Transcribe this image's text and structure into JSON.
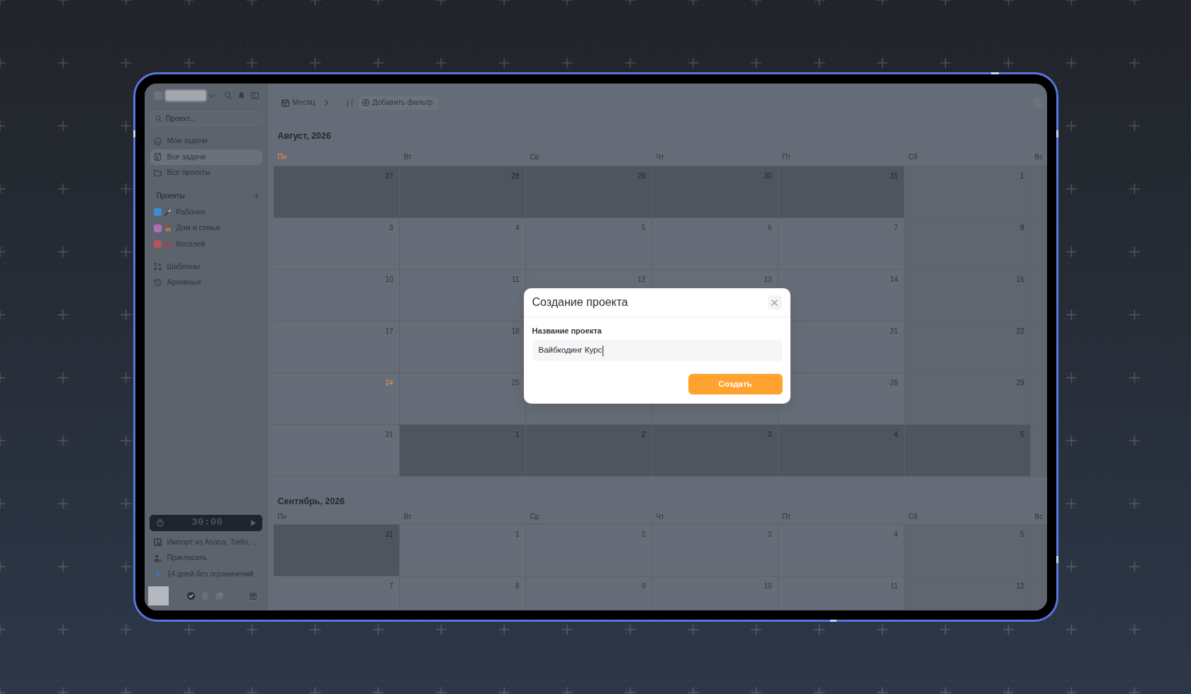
{
  "sidebar": {
    "search": {
      "placeholder": "Проект..."
    },
    "nav": [
      {
        "label": "Мои задачи",
        "selected": false
      },
      {
        "label": "Все задачи",
        "selected": true
      },
      {
        "label": "Все проекты",
        "selected": false
      }
    ],
    "projects_heading": "Проекты",
    "projects": [
      {
        "color": "#3d8bd0",
        "name": "Рабочее"
      },
      {
        "color": "#b36bb5",
        "name": "Дом и семья"
      },
      {
        "color": "#b5525c",
        "name": "Косплей"
      }
    ],
    "links": [
      {
        "label": "Шаблоны"
      },
      {
        "label": "Архивные"
      }
    ],
    "timer": {
      "time": "30:00"
    },
    "footer_links": [
      {
        "label": "Импорт из Asana, Trello, ..."
      },
      {
        "label": "Пригласить"
      },
      {
        "label": "14 дней без ограничений"
      }
    ]
  },
  "toolbar": {
    "view": "Месяц",
    "filter": "Добавить фильтр"
  },
  "months": [
    {
      "title": "Август, 2026",
      "weekdays": [
        {
          "label": "Пн",
          "today": true
        },
        {
          "label": "Вт",
          "today": false
        },
        {
          "label": "Ср",
          "today": false
        },
        {
          "label": "Чт",
          "today": false
        },
        {
          "label": "Пт",
          "today": false
        },
        {
          "label": "Сб",
          "today": false
        },
        {
          "label": "Вс",
          "today": false
        }
      ],
      "weeks": [
        [
          {
            "day": "27",
            "outside": true,
            "today": false
          },
          {
            "day": "28",
            "outside": true,
            "today": false
          },
          {
            "day": "29",
            "outside": true,
            "today": false
          },
          {
            "day": "30",
            "outside": true,
            "today": false
          },
          {
            "day": "31",
            "outside": true,
            "today": false
          },
          {
            "day": "1",
            "outside": false,
            "today": false
          }
        ],
        [
          {
            "day": "3",
            "outside": false,
            "today": false
          },
          {
            "day": "4",
            "outside": false,
            "today": false
          },
          {
            "day": "5",
            "outside": false,
            "today": false
          },
          {
            "day": "6",
            "outside": false,
            "today": false
          },
          {
            "day": "7",
            "outside": false,
            "today": false
          },
          {
            "day": "8",
            "outside": false,
            "today": false
          }
        ],
        [
          {
            "day": "10",
            "outside": false,
            "today": false
          },
          {
            "day": "11",
            "outside": false,
            "today": false
          },
          {
            "day": "12",
            "outside": false,
            "today": false
          },
          {
            "day": "13",
            "outside": false,
            "today": false
          },
          {
            "day": "14",
            "outside": false,
            "today": false
          },
          {
            "day": "15",
            "outside": false,
            "today": false
          }
        ],
        [
          {
            "day": "17",
            "outside": false,
            "today": false
          },
          {
            "day": "18",
            "outside": false,
            "today": false
          },
          {
            "day": "21",
            "outside": false,
            "today": false
          },
          {
            "day": "22",
            "outside": false,
            "today": false
          }
        ],
        [
          {
            "day": "24",
            "outside": false,
            "today": true
          },
          {
            "day": "25",
            "outside": false,
            "today": false
          },
          {
            "day": "28",
            "outside": false,
            "today": false
          },
          {
            "day": "29",
            "outside": false,
            "today": false
          }
        ],
        [
          {
            "day": "31",
            "outside": false,
            "today": false
          },
          {
            "day": "1",
            "outside": true,
            "today": false
          },
          {
            "day": "2",
            "outside": true,
            "today": false
          },
          {
            "day": "3",
            "outside": true,
            "today": false
          },
          {
            "day": "4",
            "outside": true,
            "today": false
          },
          {
            "day": "5",
            "outside": true,
            "today": false
          }
        ]
      ]
    },
    {
      "title": "Сентябрь, 2026",
      "weekdays": [
        {
          "label": "Пн",
          "today": false
        },
        {
          "label": "Вт",
          "today": false
        },
        {
          "label": "Ср",
          "today": false
        },
        {
          "label": "Чт",
          "today": false
        },
        {
          "label": "Пт",
          "today": false
        },
        {
          "label": "Сб",
          "today": false
        },
        {
          "label": "Вс",
          "today": false
        }
      ],
      "weeks": [
        [
          {
            "day": "31",
            "outside": true,
            "today": false
          },
          {
            "day": "1",
            "outside": false,
            "today": false
          },
          {
            "day": "2",
            "outside": false,
            "today": false
          },
          {
            "day": "3",
            "outside": false,
            "today": false
          },
          {
            "day": "4",
            "outside": false,
            "today": false
          },
          {
            "day": "5",
            "outside": false,
            "today": false
          }
        ],
        [
          {
            "day": "7",
            "outside": false,
            "today": false
          },
          {
            "day": "8",
            "outside": false,
            "today": false
          },
          {
            "day": "9",
            "outside": false,
            "today": false
          },
          {
            "day": "10",
            "outside": false,
            "today": false
          },
          {
            "day": "11",
            "outside": false,
            "today": false
          },
          {
            "day": "12",
            "outside": false,
            "today": false
          }
        ]
      ]
    }
  ],
  "dialog": {
    "title": "Создание проекта",
    "field_label": "Название проекта",
    "field_value": "Вайбкодинг Курс",
    "submit": "Создать"
  }
}
